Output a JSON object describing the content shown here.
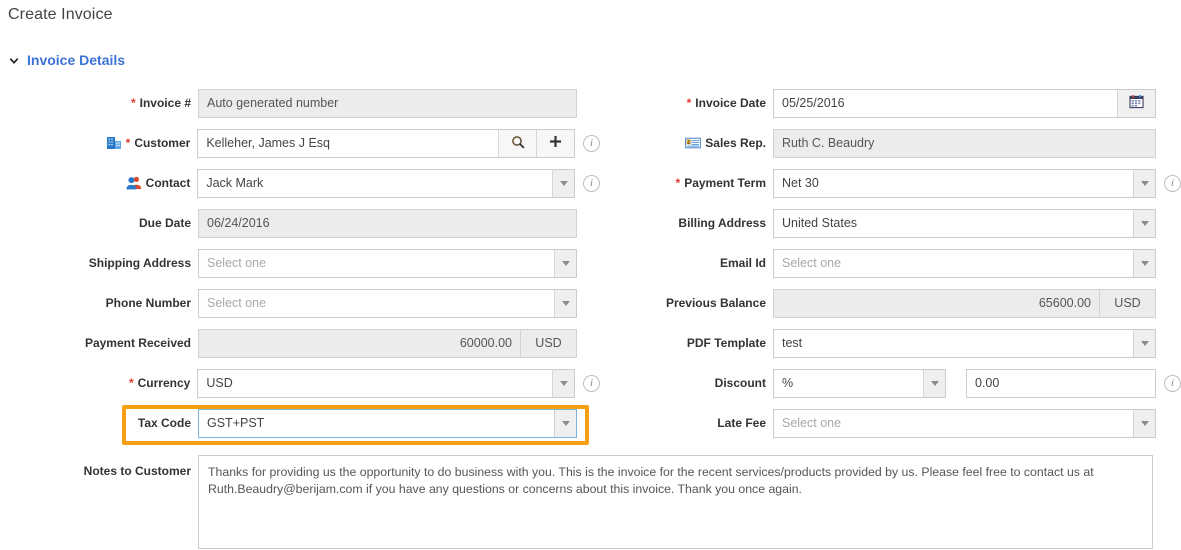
{
  "page": {
    "title": "Create Invoice"
  },
  "section": {
    "title": "Invoice Details",
    "expanded": true
  },
  "accent": {
    "section_blue": "#3b73d6",
    "required_red": "#e03b2f",
    "highlight_orange": "#f5a012",
    "focus_blue": "#7eb3e0"
  },
  "left": {
    "invoice_number": {
      "label": "Invoice #",
      "required": true,
      "value": "",
      "placeholder": "Auto generated number",
      "readonly": true
    },
    "customer": {
      "label": "Customer",
      "required": true,
      "icon": "building-icon",
      "value": "Kelleher, James J Esq",
      "search_icon": "search-icon",
      "add_icon": "plus-icon",
      "info_icon": "info-icon"
    },
    "contact": {
      "label": "Contact",
      "icon": "people-icon",
      "value": "Jack Mark",
      "info_icon": "info-icon"
    },
    "due_date": {
      "label": "Due Date",
      "value": "06/24/2016",
      "readonly": true
    },
    "shipping_address": {
      "label": "Shipping Address",
      "value": "",
      "placeholder": "Select one"
    },
    "phone_number": {
      "label": "Phone Number",
      "value": "",
      "placeholder": "Select one"
    },
    "payment_received": {
      "label": "Payment Received",
      "value": "60000.00",
      "unit": "USD",
      "readonly": true
    },
    "currency": {
      "label": "Currency",
      "required": true,
      "value": "USD",
      "info_icon": "info-icon"
    },
    "tax_code": {
      "label": "Tax Code",
      "value": "GST+PST",
      "highlighted": true,
      "focused": true
    }
  },
  "right": {
    "invoice_date": {
      "label": "Invoice Date",
      "required": true,
      "value": "05/25/2016",
      "calendar_icon": "calendar-icon"
    },
    "sales_rep": {
      "label": "Sales Rep.",
      "icon": "contact-card-icon",
      "value": "Ruth C. Beaudry",
      "readonly": true
    },
    "payment_term": {
      "label": "Payment Term",
      "required": true,
      "value": "Net 30",
      "info_icon": "info-icon"
    },
    "billing_address": {
      "label": "Billing Address",
      "value": "United States"
    },
    "email_id": {
      "label": "Email Id",
      "value": "",
      "placeholder": "Select one"
    },
    "previous_balance": {
      "label": "Previous Balance",
      "value": "65600.00",
      "unit": "USD",
      "readonly": true
    },
    "pdf_template": {
      "label": "PDF Template",
      "value": "test"
    },
    "discount": {
      "label": "Discount",
      "type_value": "%",
      "amount_value": "0.00",
      "info_icon": "info-icon"
    },
    "late_fee": {
      "label": "Late Fee",
      "value": "",
      "placeholder": "Select one"
    }
  },
  "notes": {
    "label": "Notes to Customer",
    "value": "Thanks for providing us the opportunity to do business with you. This is the invoice for the recent services/products provided by us. Please feel free to contact us at Ruth.Beaudry@berijam.com if you have any questions or concerns about this invoice. Thank you once again."
  }
}
